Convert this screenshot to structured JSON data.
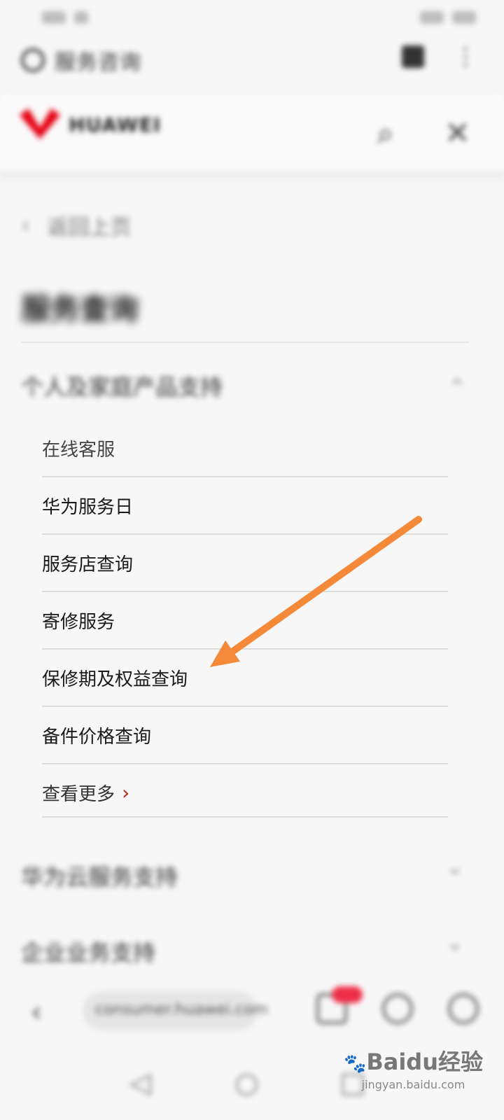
{
  "status_bar": {
    "carrier": "",
    "time": ""
  },
  "browser_bar": {
    "title": "服务咨询"
  },
  "header": {
    "brand": "HUAWEI"
  },
  "nav": {
    "back_label": "返回上页"
  },
  "page": {
    "title": "服务查询"
  },
  "sections": [
    {
      "label": "个人及家庭产品支持"
    },
    {
      "label": "华为云服务支持"
    },
    {
      "label": "企业业务支持"
    }
  ],
  "list_items": [
    {
      "label": "在线客服"
    },
    {
      "label": "华为服务日"
    },
    {
      "label": "服务店查询"
    },
    {
      "label": "寄修服务"
    },
    {
      "label": "保修期及权益查询"
    },
    {
      "label": "备件价格查询"
    },
    {
      "label": "查看更多"
    }
  ],
  "bottom_bar": {
    "url": "consumer.huawei.com"
  },
  "watermark": {
    "main": "Baidu经验",
    "sub": "jingyan.baidu.com"
  },
  "colors": {
    "accent": "#c3231c",
    "arrow": "#f5893a",
    "badge": "#ef2d47",
    "brand": "#e60012"
  }
}
